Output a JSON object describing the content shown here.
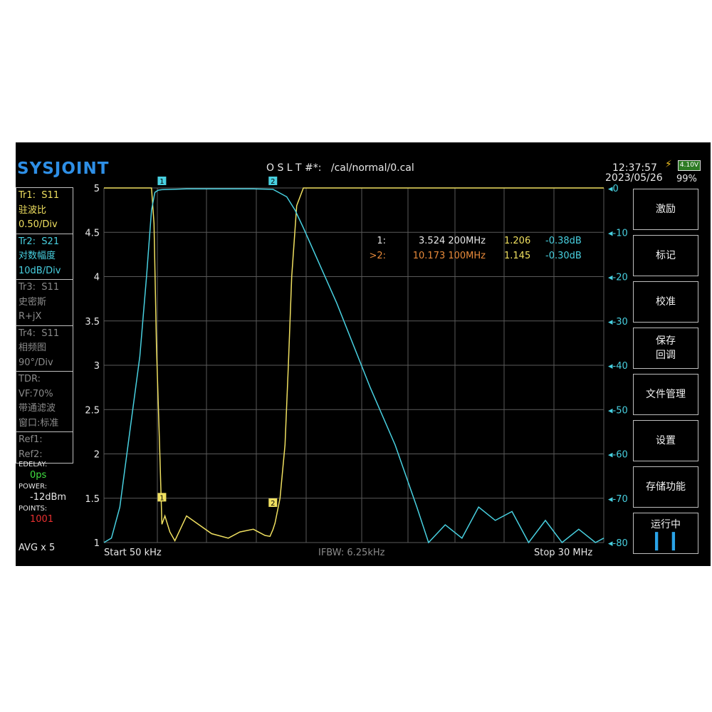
{
  "header": {
    "logo": "SYSJOINT",
    "cal_status": "O S L T #*:   /cal/normal/0.cal",
    "time": "12:37:57",
    "date": "2023/05/26",
    "battery_voltage": "4.10V",
    "battery_percent": "99%"
  },
  "traces": [
    {
      "name": "Tr1:",
      "param": "S11",
      "format": "驻波比",
      "scale": "0.50/Div",
      "color": "#f0e060",
      "active": true
    },
    {
      "name": "Tr2:",
      "param": "S21",
      "format": "对数幅度",
      "scale": "10dB/Div",
      "color": "#48d0e0",
      "active": true
    },
    {
      "name": "Tr3:",
      "param": "S11",
      "format": "史密斯",
      "scale": "R+jX",
      "color": "#8a8a8a",
      "active": false
    },
    {
      "name": "Tr4:",
      "param": "S11",
      "format": "相频图",
      "scale": "90°/Div",
      "color": "#8a8a8a",
      "active": false
    }
  ],
  "tdr": {
    "label": "TDR:",
    "vf": "VF:70%",
    "mode": "带通滤波",
    "window": "窗口:标准"
  },
  "refs": [
    "Ref1:",
    "Ref2:"
  ],
  "settings": {
    "edelay_label": "EDELAY:",
    "edelay_value": "0ps",
    "power_label": "POWER:",
    "power_value": "-12dBm",
    "points_label": "POINTS:",
    "points_value": "1001",
    "avg": "AVG x 5"
  },
  "softkeys": [
    "激励",
    "标记",
    "校准",
    "保存\n回调",
    "文件管理",
    "设置",
    "存储功能"
  ],
  "run_state": {
    "label": "运行中",
    "icon": "pause-icon"
  },
  "markers": [
    {
      "id": "1:",
      "freq": "3.524 200MHz",
      "vswr": "1.206",
      "db": "-0.38dB",
      "color": "#e6e6e6"
    },
    {
      "id": ">2:",
      "freq": "10.173 100MHz",
      "vswr": "1.145",
      "db": "-0.30dB",
      "color": "#e88a3a"
    }
  ],
  "footer": {
    "start": "Start  50 kHz",
    "ifbw": "IFBW: 6.25kHz",
    "stop": "Stop  30 MHz"
  },
  "chart_data": {
    "type": "line",
    "x_range_mhz": [
      0.05,
      30
    ],
    "left_axis": {
      "trace": "Tr1 S11 驻波比",
      "ticks": [
        "5",
        "4.5",
        "4",
        "3.5",
        "3",
        "2.5",
        "2",
        "1.5",
        "1"
      ],
      "ylim": [
        1,
        5
      ]
    },
    "right_axis": {
      "trace": "Tr2 S21 对数幅度",
      "ticks": [
        "0",
        "-10",
        "-20",
        "-30",
        "-40",
        "-50",
        "-60",
        "-70",
        "-80"
      ],
      "ylim": [
        -80,
        0
      ]
    },
    "grid": true,
    "series": [
      {
        "axis": "left",
        "color": "#f0e060",
        "x": [
          0.05,
          1.2,
          2.0,
          2.9,
          3.05,
          3.2,
          3.4,
          3.524,
          3.7,
          4.0,
          4.3,
          5.0,
          5.6,
          6.5,
          7.5,
          8.2,
          9.0,
          9.7,
          10.0,
          10.173,
          10.3,
          10.6,
          10.9,
          11.1,
          11.3,
          11.6,
          12.0,
          30
        ],
        "y": [
          5,
          5,
          5,
          5,
          4.6,
          3.2,
          2.0,
          1.206,
          1.3,
          1.12,
          1.02,
          1.3,
          1.22,
          1.1,
          1.05,
          1.12,
          1.15,
          1.08,
          1.07,
          1.145,
          1.22,
          1.5,
          2.1,
          3.0,
          4.0,
          4.8,
          5,
          5
        ]
      },
      {
        "axis": "right",
        "color": "#48d0e0",
        "x": [
          0.05,
          0.5,
          1.0,
          1.6,
          2.2,
          2.6,
          2.9,
          3.1,
          3.3,
          3.524,
          5.0,
          7.0,
          9.0,
          10.173,
          11.0,
          11.5,
          12.0,
          14.0,
          16.0,
          17.5,
          18.8,
          19.5,
          20.5,
          21.5,
          22.5,
          23.5,
          24.5,
          25.5,
          26.5,
          27.5,
          28.5,
          29.5,
          30
        ],
        "y": [
          -80,
          -79,
          -72,
          -55,
          -38,
          -20,
          -5,
          -1,
          -0.5,
          -0.38,
          -0.2,
          -0.2,
          -0.2,
          -0.3,
          -2,
          -5,
          -9,
          -26,
          -45,
          -58,
          -72,
          -80,
          -76,
          -79,
          -72,
          -75,
          -73,
          -80,
          -75,
          -80,
          -77,
          -80,
          -79
        ]
      }
    ]
  }
}
